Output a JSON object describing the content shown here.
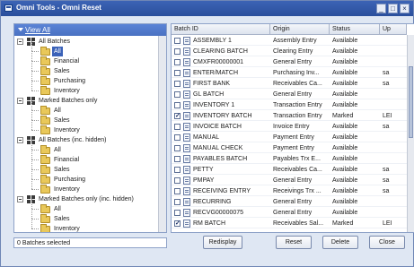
{
  "window": {
    "title": "Omni Tools - Omni Reset",
    "minimize": "_",
    "restore": "□",
    "close": "×"
  },
  "left": {
    "view_all": "View All",
    "tree": [
      {
        "label": "All Batches",
        "kind": "group"
      },
      {
        "label": "All",
        "kind": "leaf",
        "selected": true
      },
      {
        "label": "Financial",
        "kind": "leaf"
      },
      {
        "label": "Sales",
        "kind": "leaf"
      },
      {
        "label": "Purchasing",
        "kind": "leaf"
      },
      {
        "label": "Inventory",
        "kind": "leaf"
      },
      {
        "label": "Marked Batches only",
        "kind": "group"
      },
      {
        "label": "All",
        "kind": "leaf"
      },
      {
        "label": "Sales",
        "kind": "leaf"
      },
      {
        "label": "Inventory",
        "kind": "leaf"
      },
      {
        "label": "All Batches (inc. hidden)",
        "kind": "group"
      },
      {
        "label": "All",
        "kind": "leaf"
      },
      {
        "label": "Financial",
        "kind": "leaf"
      },
      {
        "label": "Sales",
        "kind": "leaf"
      },
      {
        "label": "Purchasing",
        "kind": "leaf"
      },
      {
        "label": "Inventory",
        "kind": "leaf"
      },
      {
        "label": "Marked Batches only (inc. hidden)",
        "kind": "group"
      },
      {
        "label": "All",
        "kind": "leaf"
      },
      {
        "label": "Sales",
        "kind": "leaf"
      },
      {
        "label": "Inventory",
        "kind": "leaf"
      }
    ]
  },
  "grid": {
    "columns": [
      "Batch ID",
      "Origin",
      "Status",
      "Up"
    ],
    "rows": [
      {
        "id": "ASSEMBLY 1",
        "origin": "Assembly Entry",
        "status": "Available",
        "up": "",
        "checked": false
      },
      {
        "id": "CLEARING BATCH",
        "origin": "Clearing Entry",
        "status": "Available",
        "up": "",
        "checked": false
      },
      {
        "id": "CMXFR00000001",
        "origin": "General Entry",
        "status": "Available",
        "up": "",
        "checked": false
      },
      {
        "id": "ENTER/MATCH",
        "origin": "Purchasing Inv...",
        "status": "Available",
        "up": "sa",
        "checked": false
      },
      {
        "id": "FIRST BANK",
        "origin": "Receivables Ca...",
        "status": "Available",
        "up": "sa",
        "checked": false
      },
      {
        "id": "GL BATCH",
        "origin": "General Entry",
        "status": "Available",
        "up": "",
        "checked": false
      },
      {
        "id": "INVENTORY 1",
        "origin": "Transaction Entry",
        "status": "Available",
        "up": "",
        "checked": false
      },
      {
        "id": "INVENTORY BATCH",
        "origin": "Transaction Entry",
        "status": "Marked",
        "up": "LEI",
        "checked": true
      },
      {
        "id": "INVOICE BATCH",
        "origin": "Invoice Entry",
        "status": "Available",
        "up": "sa",
        "checked": false
      },
      {
        "id": "MANUAL",
        "origin": "Payment Entry",
        "status": "Available",
        "up": "",
        "checked": false
      },
      {
        "id": "MANUAL CHECK",
        "origin": "Payment Entry",
        "status": "Available",
        "up": "",
        "checked": false
      },
      {
        "id": "PAYABLES BATCH",
        "origin": "Payables Trx E...",
        "status": "Available",
        "up": "",
        "checked": false
      },
      {
        "id": "PETTY",
        "origin": "Receivables Ca...",
        "status": "Available",
        "up": "sa",
        "checked": false
      },
      {
        "id": "PMPAY",
        "origin": "General Entry",
        "status": "Available",
        "up": "sa",
        "checked": false
      },
      {
        "id": "RECEIVING ENTRY",
        "origin": "Receivings Trx ...",
        "status": "Available",
        "up": "sa",
        "checked": false
      },
      {
        "id": "RECURRING",
        "origin": "General Entry",
        "status": "Available",
        "up": "",
        "checked": false
      },
      {
        "id": "RECVG00000075",
        "origin": "General Entry",
        "status": "Available",
        "up": "",
        "checked": false
      },
      {
        "id": "RM BATCH",
        "origin": "Receivables Sal...",
        "status": "Marked",
        "up": "LEI",
        "checked": true
      }
    ]
  },
  "footer": {
    "status_text": "0 Batches selected",
    "redisplay": "Redisplay",
    "reset": "Reset",
    "delete": "Delete",
    "close": "Close"
  }
}
